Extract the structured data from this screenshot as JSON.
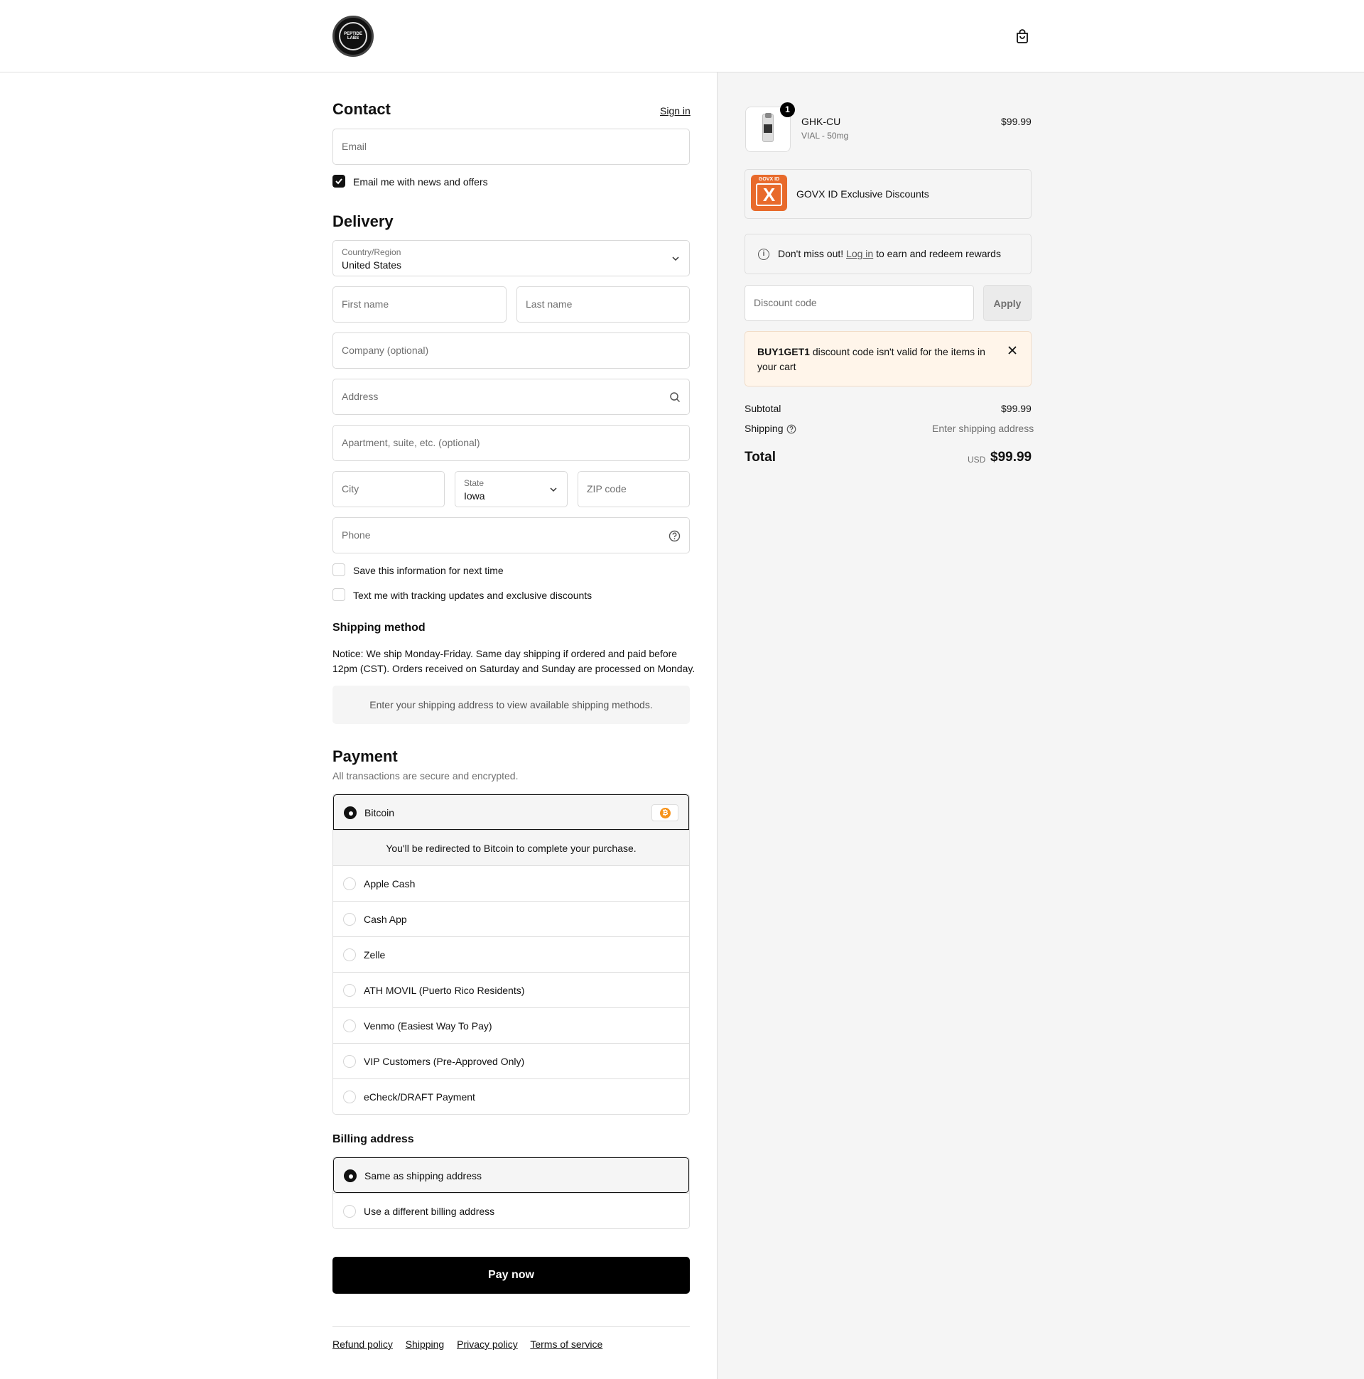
{
  "header": {
    "logo_text": "PEPTIDE LABS"
  },
  "contact": {
    "title": "Contact",
    "sign_in": "Sign in",
    "email_placeholder": "Email",
    "news_label": "Email me with news and offers"
  },
  "delivery": {
    "title": "Delivery",
    "country_label": "Country/Region",
    "country_value": "United States",
    "first_name": "First name",
    "last_name": "Last name",
    "company": "Company (optional)",
    "address": "Address",
    "apartment": "Apartment, suite, etc. (optional)",
    "city": "City",
    "state_label": "State",
    "state_value": "Iowa",
    "zip": "ZIP code",
    "phone": "Phone",
    "save_info": "Save this information for next time",
    "text_me": "Text me with tracking updates and exclusive discounts"
  },
  "shipping_method": {
    "title": "Shipping method",
    "notice_line1": "Notice: We ship Monday-Friday. Same day shipping if ordered and paid before",
    "notice_line2": "12pm (CST). Orders received on Saturday and Sunday are processed on Monday.",
    "empty": "Enter your shipping address to view available shipping methods."
  },
  "payment": {
    "title": "Payment",
    "subtitle": "All transactions are secure and encrypted.",
    "selected": "Bitcoin",
    "redirect": "You'll be redirected to Bitcoin to complete your purchase.",
    "options": [
      "Apple Cash",
      "Cash App",
      "Zelle",
      "ATH MOVIL (Puerto Rico Residents)",
      "Venmo (Easiest Way To Pay)",
      "VIP Customers (Pre-Approved Only)",
      "eCheck/DRAFT Payment"
    ]
  },
  "billing": {
    "title": "Billing address",
    "same": "Same as shipping address",
    "different": "Use a different billing address"
  },
  "pay_now": "Pay now",
  "footer": [
    "Refund policy",
    "Shipping",
    "Privacy policy",
    "Terms of service"
  ],
  "summary": {
    "item_name": "GHK-CU",
    "item_variant": "VIAL - 50mg",
    "item_price": "$99.99",
    "item_qty": "1",
    "govx_badge": "GOVX ID",
    "govx_label": "GOVX ID Exclusive Discounts",
    "rewards_pre": "Don't miss out!",
    "rewards_link": "Log in",
    "rewards_post": "to earn and redeem rewards",
    "discount_placeholder": "Discount code",
    "apply": "Apply",
    "alert_code": "BUY1GET1",
    "alert_line1": "discount code isn't valid for the items in",
    "alert_line2": "your cart",
    "subtotal_label": "Subtotal",
    "subtotal_value": "$99.99",
    "shipping_label": "Shipping",
    "shipping_value": "Enter shipping address",
    "total_label": "Total",
    "currency": "USD",
    "total_value": "$99.99"
  },
  "colors": {
    "accent": "#000000",
    "govx": "#e86a2b",
    "bitcoin": "#f7931a",
    "alert_bg": "#fff5ea"
  }
}
